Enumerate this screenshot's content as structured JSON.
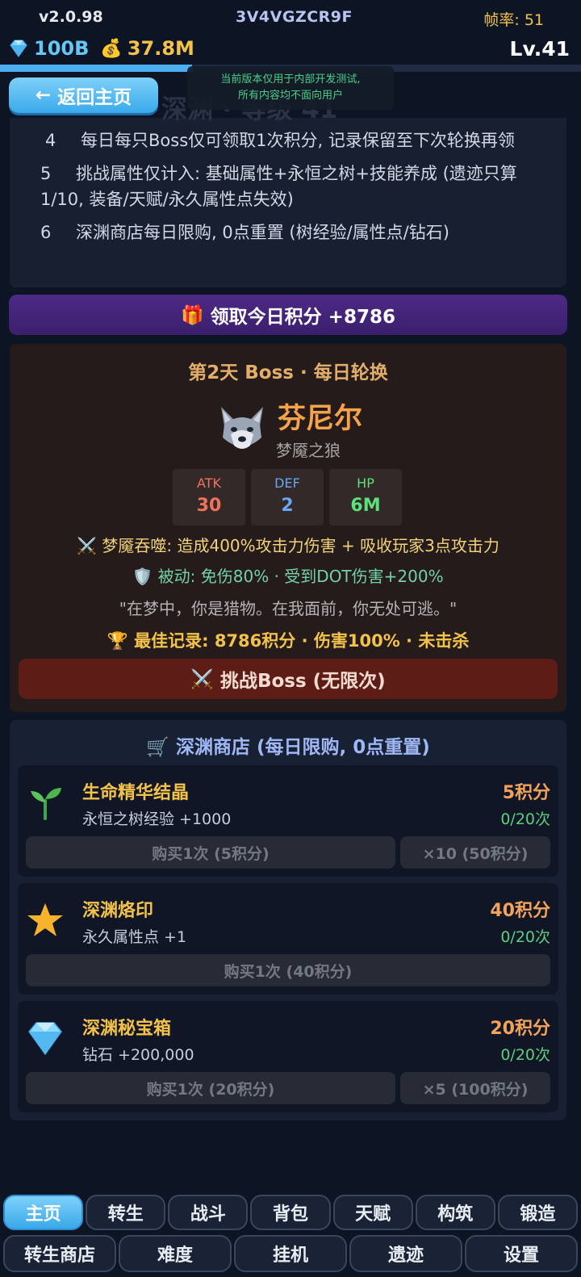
{
  "header": {
    "version": "v2.0.98",
    "uid": "3V4VGZCR9F",
    "fps": "帧率: 51",
    "diamonds": "100B",
    "gold": "37.8M",
    "level": "Lv.41",
    "xp_progress": 0.33,
    "ghost_title": "深渊  ·  等级 41"
  },
  "back_button": {
    "label": "返回主页"
  },
  "notice": {
    "line1": "当前版本仅用于内部开发测试,",
    "line2": "所有内容均不面向用户"
  },
  "rules": [
    {
      "num": "4",
      "text": "每日每只Boss仅可领取1次积分, 记录保留至下次轮换再领"
    },
    {
      "num": "5",
      "text": "挑战属性仅计入: 基础属性+永恒之树+技能养成 (遗迹只算1/10, 装备/天赋/永久属性点失效)"
    },
    {
      "num": "6",
      "text": "深渊商店每日限购, 0点重置 (树经验/属性点/钻石)"
    }
  ],
  "claim": {
    "label": "领取今日积分 +8786"
  },
  "boss": {
    "header": "第2天 Boss · 每日轮换",
    "name": "芬尼尔",
    "subtitle": "梦魇之狼",
    "stats": [
      {
        "label": "ATK",
        "value": "30",
        "color": "#f0725c"
      },
      {
        "label": "DEF",
        "value": "2",
        "color": "#6aa5f0"
      },
      {
        "label": "HP",
        "value": "6M",
        "color": "#5ee07a"
      }
    ],
    "skill": "梦魇吞噬: 造成400%攻击力伤害 + 吸收玩家3点攻击力",
    "passive": "被动: 免伤80% · 受到DOT伤害+200%",
    "quote": "\"在梦中，你是猎物。在我面前，你无处可逃。\"",
    "record": "最佳记录: 8786积分 · 伤害100% · 未击杀",
    "challenge_label": "挑战Boss (无限次)"
  },
  "shop": {
    "title": "深渊商店 (每日限购, 0点重置)",
    "items": [
      {
        "name": "生命精华结晶",
        "desc": "永恒之树经验 +1000",
        "cost": "5积分",
        "limit": "0/20次",
        "buy1": "购买1次 (5积分)",
        "buy_multi": "×10 (50积分)",
        "icon": "sprout-icon"
      },
      {
        "name": "深渊烙印",
        "desc": "永久属性点 +1",
        "cost": "40积分",
        "limit": "0/20次",
        "buy1": "购买1次 (40积分)",
        "icon": "star-icon"
      },
      {
        "name": "深渊秘宝箱",
        "desc": "钻石 +200,000",
        "cost": "20积分",
        "limit": "0/20次",
        "buy1": "购买1次 (20积分)",
        "buy_multi": "×5 (100积分)",
        "icon": "diamond-icon"
      }
    ]
  },
  "nav": {
    "row1": [
      "主页",
      "转生",
      "战斗",
      "背包",
      "天赋",
      "构筑",
      "锻造"
    ],
    "row2": [
      "转生商店",
      "难度",
      "挂机",
      "遗迹",
      "设置"
    ]
  }
}
